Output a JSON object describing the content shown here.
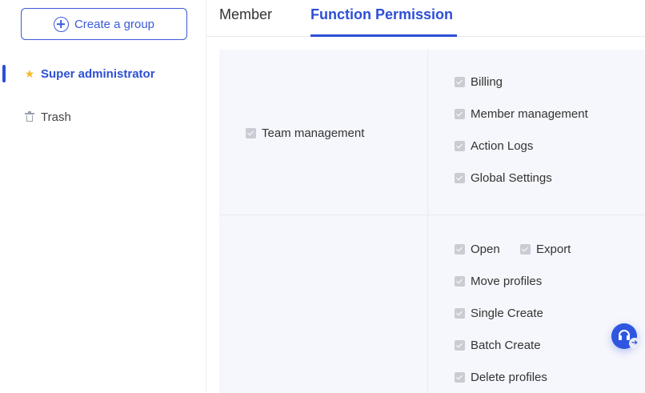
{
  "sidebar": {
    "create_button": "Create a group",
    "items": [
      {
        "label": "Super administrator",
        "icon": "star-icon",
        "active": true
      },
      {
        "label": "Trash",
        "icon": "trash-icon",
        "active": false
      }
    ]
  },
  "tabs": [
    {
      "label": "Member",
      "active": false
    },
    {
      "label": "Function Permission",
      "active": true
    }
  ],
  "permissions": {
    "team_management": {
      "label": "Team management",
      "items": [
        "Billing",
        "Member management",
        "Action Logs",
        "Global Settings"
      ]
    },
    "profiles": {
      "items": [
        "Open",
        "Export",
        "Move profiles",
        "Single Create",
        "Batch Create",
        "Delete profiles"
      ]
    }
  },
  "colors": {
    "accent": "#2d4fd6",
    "star": "#f5b82e",
    "checkbox": "#c9ccd4",
    "table_bg": "#f6f7fc"
  },
  "support": {
    "icon": "headset-icon"
  }
}
